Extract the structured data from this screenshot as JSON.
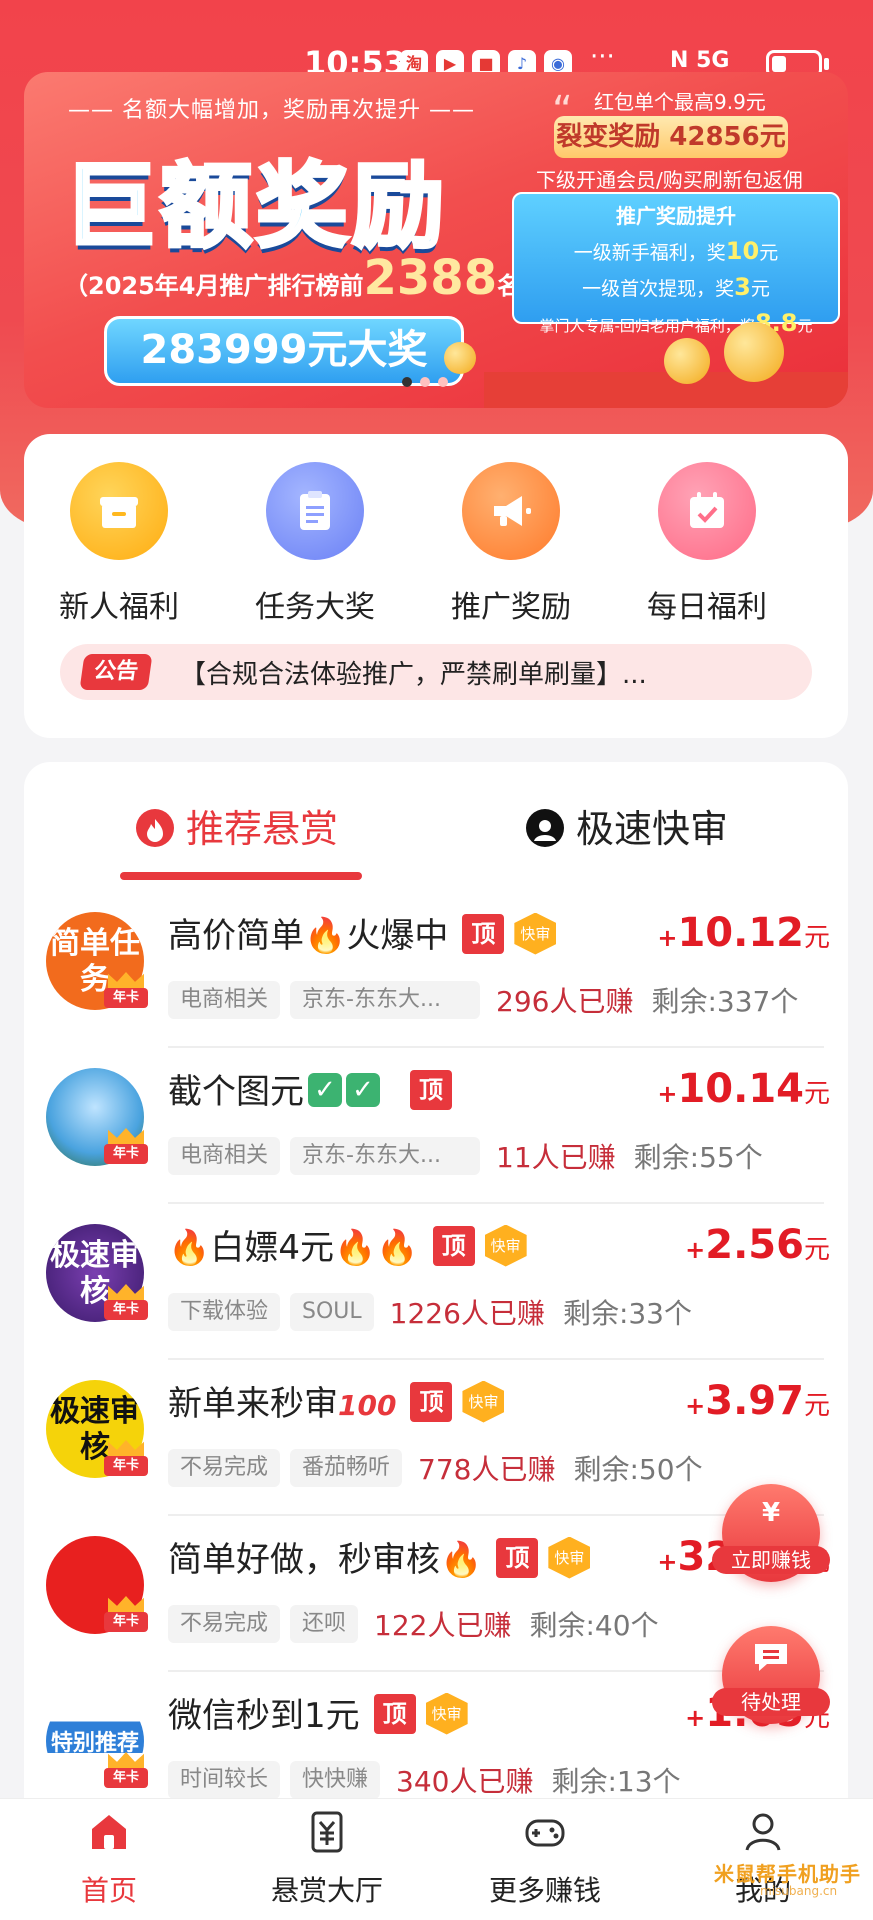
{
  "status_bar": {
    "time": "10:53",
    "app_icons": [
      "淘",
      "▶",
      "■",
      "♪",
      "◉"
    ],
    "overflow": "···",
    "network": "N 5G"
  },
  "banner": {
    "subtitle": "—— 名额大幅增加，奖励再次提升 ——",
    "headline": "巨额奖励",
    "rank_prefix": "（2025年4月推广排行榜前",
    "rank_number": "2388",
    "rank_suffix": "名）",
    "prize": "283999元大奖",
    "quote_mark": "“",
    "hongbao_text": "红包单个最高9.9元",
    "fission_reward": "裂变奖励 42856元",
    "rebate_text": "下级开通会员/购买刷新包返佣",
    "promo": {
      "title": "推广奖励提升",
      "line1_prefix": "一级新手福利，奖",
      "line1_value": "10",
      "line1_suffix": "元",
      "line2_prefix": "一级首次提现，奖",
      "line2_value": "3",
      "line2_suffix": "元",
      "line3_prefix": "掌门人专属-回归老用户福利，奖",
      "line3_value": "8.8",
      "line3_suffix": "元"
    }
  },
  "menu": {
    "items": [
      {
        "label": "新人福利",
        "icon": "gift-box-icon",
        "color": "#ffb81f"
      },
      {
        "label": "任务大奖",
        "icon": "clipboard-icon",
        "color": "#6f8cff"
      },
      {
        "label": "推广奖励",
        "icon": "megaphone-icon",
        "color": "#ff8a3a"
      },
      {
        "label": "每日福利",
        "icon": "calendar-check-icon",
        "color": "#ff6f8a"
      }
    ],
    "notice_tag": "公告",
    "notice_text": "【合规合法体验推广，严禁刷单刷量】..."
  },
  "tabs": {
    "recommended": "推荐悬赏",
    "fast_review": "极速快审"
  },
  "badges": {
    "top": "顶",
    "fast": "快审",
    "year_card": "年卡"
  },
  "tasks": [
    {
      "avatar_text": "简单任务",
      "avatar_color": "#f26b1d",
      "title": "高价简单",
      "title_suffix": "火爆中",
      "emoji": "fire",
      "reward_plus": "+",
      "reward": "10.12",
      "reward_unit": "元",
      "tags": [
        "电商相关",
        "京东-东东大..."
      ],
      "earned_count": "296人",
      "earned_label": "已赚",
      "remaining": "剩余:337个",
      "has_fast": true
    },
    {
      "avatar_text": "",
      "avatar_color": "#4aa3df",
      "title": "截个图元",
      "title_suffix": "",
      "emoji": "check",
      "reward_plus": "+",
      "reward": "10.14",
      "reward_unit": "元",
      "tags": [
        "电商相关",
        "京东-东东大..."
      ],
      "earned_count": "11人",
      "earned_label": "已赚",
      "remaining": "剩余:55个",
      "has_fast": false
    },
    {
      "avatar_text": "极速审核",
      "avatar_color": "#5a2d8c",
      "title": "白嫖4元",
      "title_suffix": "",
      "emoji": "fire3",
      "reward_plus": "+",
      "reward": "2.56",
      "reward_unit": "元",
      "tags": [
        "下载体验",
        "SOUL"
      ],
      "earned_count": "1226人",
      "earned_label": "已赚",
      "remaining": "剩余:33个",
      "has_fast": true
    },
    {
      "avatar_text": "极速审核",
      "avatar_color": "#f5d30a",
      "title": "新单来秒审",
      "title_suffix": "",
      "emoji": "100",
      "reward_plus": "+",
      "reward": "3.97",
      "reward_unit": "元",
      "tags": [
        "不易完成",
        "番茄畅听"
      ],
      "earned_count": "778人",
      "earned_label": "已赚",
      "remaining": "剩余:50个",
      "has_fast": true
    },
    {
      "avatar_text": "",
      "avatar_color": "#e8201f",
      "title": "简单好做，秒审核",
      "title_suffix": "",
      "emoji": "fire",
      "reward_plus": "+",
      "reward": "32.15",
      "reward_unit": "元",
      "tags": [
        "不易完成",
        "还呗"
      ],
      "earned_count": "122人",
      "earned_label": "已赚",
      "remaining": "剩余:40个",
      "has_fast": true
    },
    {
      "avatar_text": "特别推荐",
      "avatar_color": "#2e7fd8",
      "title": "微信秒到1元",
      "title_suffix": "",
      "emoji": "",
      "reward_plus": "+",
      "reward": "1.05",
      "reward_unit": "元",
      "tags": [
        "时间较长",
        "快快赚"
      ],
      "earned_count": "340人",
      "earned_label": "已赚",
      "remaining": "剩余:13个",
      "has_fast": true
    }
  ],
  "floating": {
    "earn_now": "立即赚钱",
    "earn_icon": "¥",
    "pending": "待处理",
    "pending_icon": "chat-bubble-icon"
  },
  "bottom_nav": [
    {
      "label": "首页",
      "icon": "home-icon",
      "active": true
    },
    {
      "label": "悬赏大厅",
      "icon": "yuan-tag-icon",
      "active": false
    },
    {
      "label": "更多赚钱",
      "icon": "gamepad-icon",
      "active": false
    },
    {
      "label": "我的",
      "icon": "user-icon",
      "active": false
    }
  ],
  "watermark": {
    "text": "米鼠帮手机助手",
    "url": "misubang.cn"
  },
  "colors": {
    "brand_red": "#e8383d",
    "reward_red": "#e21c25",
    "banner_blue": "#3fc4ff"
  }
}
